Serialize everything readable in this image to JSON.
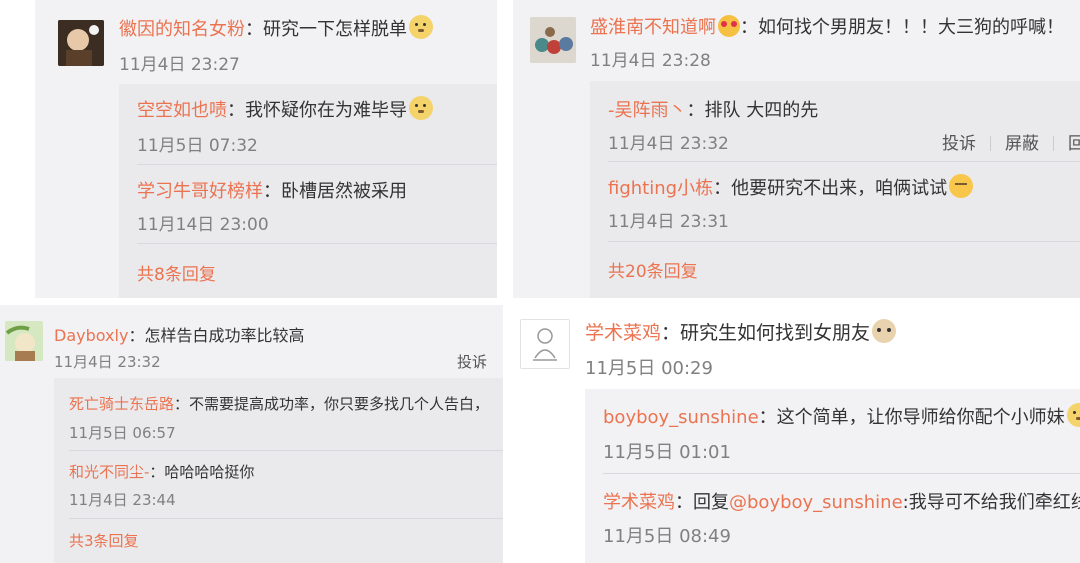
{
  "panels": [
    {
      "comment": {
        "user": "徽因的知名女粉",
        "text": "：研究一下怎样脱单",
        "time": "11月4日 23:27"
      },
      "replies": [
        {
          "user": "空空如也啧",
          "text": "：我怀疑你在为难毕导",
          "time": "11月5日 07:32"
        },
        {
          "user": "学习牛哥好榜样",
          "text": "：卧槽居然被采用",
          "time": "11月14日 23:00"
        }
      ],
      "more": "共8条回复"
    },
    {
      "comment": {
        "user": "盛淮南不知道啊",
        "text": "：如何找个男朋友！！！大三狗的呼喊！",
        "time": "11月4日 23:28"
      },
      "replies": [
        {
          "user": "-吴阵雨丶",
          "text": "：排队 大四的先",
          "time": "11月4日 23:32"
        },
        {
          "user": "fighting小栋",
          "text": "：他要研究不出来，咱俩试试",
          "time": "11月4日 23:31"
        }
      ],
      "actions": [
        "投诉",
        "屏蔽",
        "回"
      ],
      "more": "共20条回复"
    },
    {
      "comment": {
        "user": "Dayboxly",
        "text": "：怎样告白成功率比较高",
        "time": "11月4日 23:32"
      },
      "replies": [
        {
          "user": "死亡骑士东岳路",
          "text": "：不需要提高成功率，你只要多找几个人告白，",
          "time": "11月5日 06:57"
        },
        {
          "user": "和光不同尘-",
          "text": "：哈哈哈哈挺你",
          "time": "11月4日 23:44"
        }
      ],
      "actions": [
        "投诉"
      ],
      "more": "共3条回复"
    },
    {
      "comment": {
        "user": "学术菜鸡",
        "text": "：研究生如何找到女朋友",
        "time": "11月5日 00:29"
      },
      "replies": [
        {
          "user": "boyboy_sunshine",
          "text": "：这个简单，让你导师给你配个小师妹",
          "time": "11月5日 01:01"
        },
        {
          "user": "学术菜鸡",
          "text": "：回复",
          "mention": "@boyboy_sunshine",
          "text2": ":我导可不给我们牵红线",
          "time": "11月5日 08:49"
        }
      ]
    }
  ],
  "colors": {
    "username": "#eb7350",
    "timestamp": "#808080",
    "panel_bg": "#f2f2f5",
    "reply_bg": "#eaeaed"
  },
  "icons": [
    "doge-emoji",
    "heart-eyes-emoji",
    "sweat-emoji",
    "cat-emoji"
  ]
}
